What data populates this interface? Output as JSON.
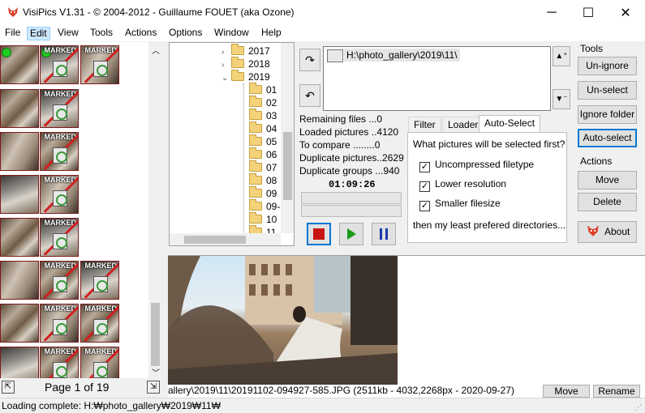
{
  "window": {
    "title": "VisiPics V1.31 - © 2004-2012 - Guillaume FOUET (aka Ozone)",
    "minimize": "─",
    "maximize": "☐",
    "close": "✕"
  },
  "menu": [
    "File",
    "Edit",
    "View",
    "Tools",
    "Actions",
    "Options",
    "Window",
    "Help"
  ],
  "thumbs": {
    "marked_label": "MARKED"
  },
  "pager": {
    "label": "Page 1 of 19"
  },
  "tree": {
    "years": [
      "2017",
      "2018",
      "2019"
    ],
    "months": [
      "01",
      "02",
      "03",
      "04",
      "05",
      "06",
      "07",
      "08",
      "09",
      "09-",
      "10",
      "11"
    ]
  },
  "path_list": {
    "entry": "H:\\photo_gallery\\2019\\11\\"
  },
  "stats": {
    "remaining": "Remaining files ...0",
    "loaded": "Loaded pictures ..4120",
    "to_compare": "To compare ........0",
    "duplicates": "Duplicate pictures..2629",
    "groups": "Duplicate groups ...940",
    "timer": "01:09:26"
  },
  "tabs": [
    "Filter",
    "Loader",
    "Auto-Select"
  ],
  "autoselect": {
    "question": "What pictures will be selected first?",
    "options": [
      "Uncompressed filetype",
      "Lower resolution",
      "Smaller filesize"
    ],
    "footer": "then my least prefered directories..."
  },
  "tools": {
    "heading": "Tools",
    "unignore": "Un-ignore",
    "unselect": "Un-select",
    "ignore_folder": "Ignore folder",
    "autoselect": "Auto-select"
  },
  "actions": {
    "heading": "Actions",
    "move": "Move",
    "delete": "Delete",
    "about": "About"
  },
  "preview": {
    "info": "allery\\2019\\11\\20191102-094927-585.JPG (2511kb - 4032,2268px - 2020-09-27)",
    "move": "Move",
    "rename": "Rename"
  },
  "status": {
    "text": "Loading complete: H:₩photo_gallery₩2019₩11₩"
  },
  "colors": {
    "accent": "#0078d7",
    "marked": "#7b1a1a",
    "stop": "#c81414",
    "play": "#1a9a1a",
    "pause": "#1a3aaa"
  }
}
